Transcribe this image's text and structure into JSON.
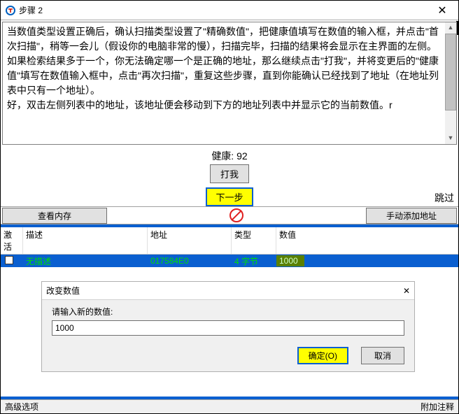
{
  "window": {
    "title": "步骤 2"
  },
  "text": {
    "p1": "当数值类型设置正确后，确认扫描类型设置了\"精确数值\"，把健康值填写在数值的输入框，并点击\"首次扫描\"，稍等一会儿（假设你的电脑非常的慢），扫描完毕，扫描的结果将会显示在主界面的左侧。",
    "p2": "如果检索结果多于一个，你无法确定哪一个是正确的地址，那么继续点击\"打我\"，并将变更后的\"健康值\"填写在数值输入框中，点击\"再次扫描\"，重复这些步骤，直到你能确认已经找到了地址（在地址列表中只有一个地址）。",
    "p3": "好，双击左侧列表中的地址，该地址便会移动到下方的地址列表中并显示它的当前数值。r"
  },
  "middle": {
    "health_label": "健康:",
    "health_value": "92",
    "hit_me": "打我",
    "next": "下一步",
    "skip": "跳过"
  },
  "toolbar": {
    "view_memory": "查看内存",
    "add_manual": "手动添加地址"
  },
  "table": {
    "headers": {
      "activate": "激活",
      "desc": "描述",
      "addr": "地址",
      "type": "类型",
      "value": "数值"
    },
    "row": {
      "desc": "无描述",
      "addr": "017584E0",
      "type": "4 字节",
      "value": "1000"
    }
  },
  "dialog": {
    "title": "改变数值",
    "prompt": "请输入新的数值:",
    "input_value": "1000",
    "ok": "确定(O)",
    "cancel": "取消"
  },
  "status": {
    "left": "高级选项",
    "right": "附加注释"
  }
}
